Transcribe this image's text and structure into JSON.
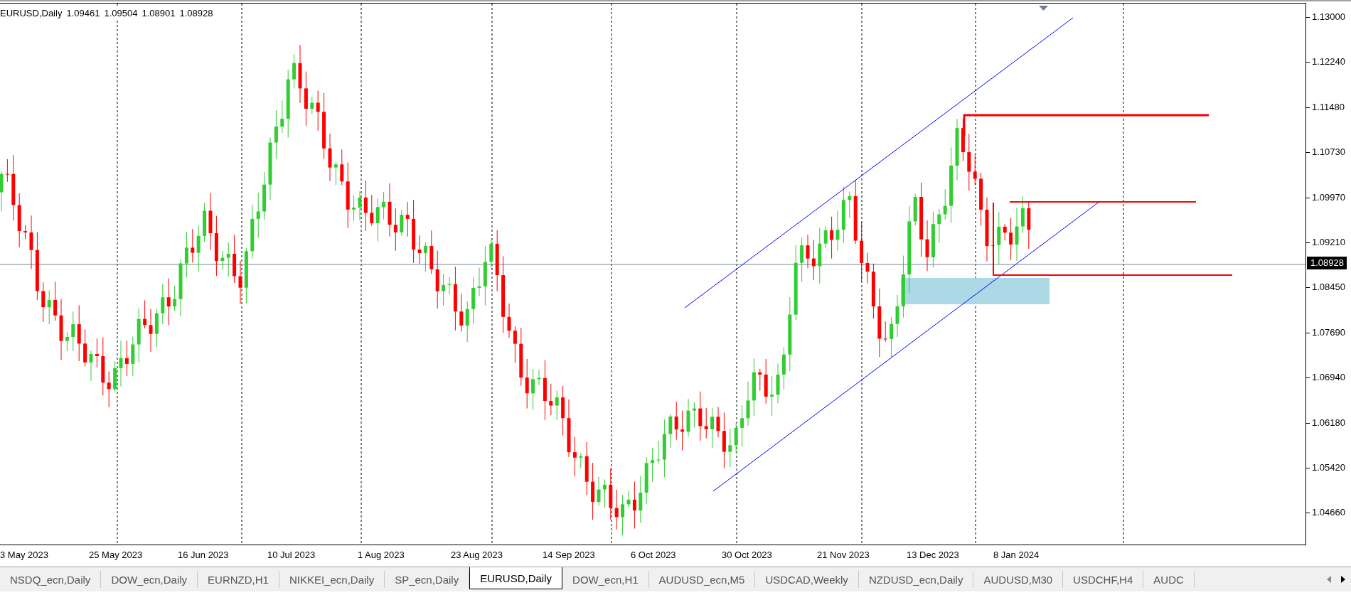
{
  "header": {
    "symbol_timeframe": "EURUSD,Daily",
    "ohlc": [
      "1.09461",
      "1.09504",
      "1.08901",
      "1.08928"
    ]
  },
  "price_axis": {
    "labels": [
      "1.13000",
      "1.12240",
      "1.11480",
      "1.10730",
      "1.09970",
      "1.09210",
      "1.08450",
      "1.07690",
      "1.06940",
      "1.06180",
      "1.05420",
      "1.04660"
    ],
    "current_price": "1.08928"
  },
  "date_axis": {
    "labels": [
      "3 May 2023",
      "25 May 2023",
      "16 Jun 2023",
      "10 Jul 2023",
      "1 Aug 2023",
      "23 Aug 2023",
      "14 Sep 2023",
      "6 Oct 2023",
      "30 Oct 2023",
      "21 Nov 2023",
      "13 Dec 2023",
      "8 Jan 2024"
    ]
  },
  "tabs": [
    {
      "label": "NSDQ_ecn,Daily",
      "selected": false
    },
    {
      "label": "DOW_ecn,Daily",
      "selected": false
    },
    {
      "label": "EURNZD,H1",
      "selected": false
    },
    {
      "label": "NIKKEI_ecn,Daily",
      "selected": false
    },
    {
      "label": "SP_ecn,Daily",
      "selected": false
    },
    {
      "label": "EURUSD,Daily",
      "selected": true
    },
    {
      "label": "DOW_ecn,H1",
      "selected": false
    },
    {
      "label": "AUDUSD_ecn,M5",
      "selected": false
    },
    {
      "label": "USDCAD,Weekly",
      "selected": false
    },
    {
      "label": "NZDUSD_ecn,Daily",
      "selected": false
    },
    {
      "label": "AUDUSD,M30",
      "selected": false
    },
    {
      "label": "USDCHF,H4",
      "selected": false
    },
    {
      "label": "AUDC",
      "selected": false
    }
  ]
}
